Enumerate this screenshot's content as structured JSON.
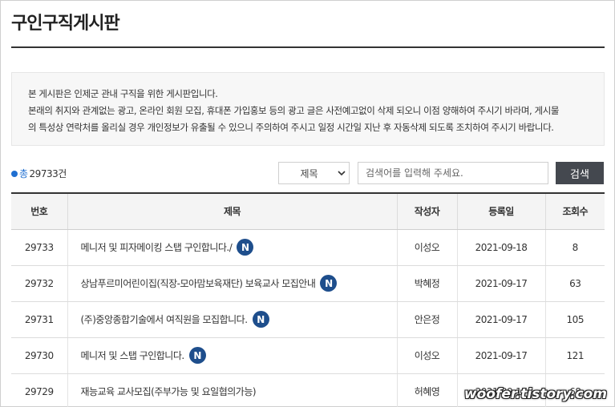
{
  "page": {
    "title": "구인구직게시판"
  },
  "notice": {
    "lines": [
      "본 게시판은 인제군 관내 구직을 위한 게시판입니다.",
      "본래의 취지와 관계없는 광고, 온라인 회원 모집, 휴대폰 가입홍보 등의 광고 글은 사전예고없이 삭제 되오니 이점 양해하여 주시기 바라며, 게시물",
      "의 특성상 연락처를 올리실 경우 개인정보가 유출될 수 있으니 주의하여 주시고 일정 시간일 지난 후 자동삭제 되도록 조치하여 주시기 바랍니다."
    ]
  },
  "search": {
    "total_label": "총",
    "total_count": "29733건",
    "field_selected": "제목",
    "placeholder": "검색어를 입력해 주세요.",
    "button_label": "검색",
    "icons": {
      "dropdown": "chevron-down-icon",
      "bullet": "dot-icon"
    }
  },
  "table": {
    "columns": [
      "번호",
      "제목",
      "작성자",
      "등록일",
      "조회수"
    ],
    "new_badge": "N",
    "rows": [
      {
        "no": "29733",
        "subject": "메니저 및 피자메이킹 스탭 구인합니다./",
        "is_new": true,
        "author": "이성오",
        "date": "2021-09-18",
        "views": "8"
      },
      {
        "no": "29732",
        "subject": "상남푸르미어린이집(직장-모아맘보육재단) 보육교사 모집안내",
        "is_new": true,
        "author": "박혜정",
        "date": "2021-09-17",
        "views": "63"
      },
      {
        "no": "29731",
        "subject": "(주)중앙종합기술에서 여직원을 모집합니다.",
        "is_new": true,
        "author": "안은정",
        "date": "2021-09-17",
        "views": "105"
      },
      {
        "no": "29730",
        "subject": "메니저 및 스탭 구인합니다.",
        "is_new": true,
        "author": "이성오",
        "date": "2021-09-17",
        "views": "121"
      },
      {
        "no": "29729",
        "subject": "재능교육 교사모집(주부가능 및 요일협의가능)",
        "is_new": false,
        "author": "허혜영",
        "date": "2021-09-17",
        "views": "68"
      }
    ]
  },
  "watermark": {
    "text": "woofer.tistory.com"
  }
}
